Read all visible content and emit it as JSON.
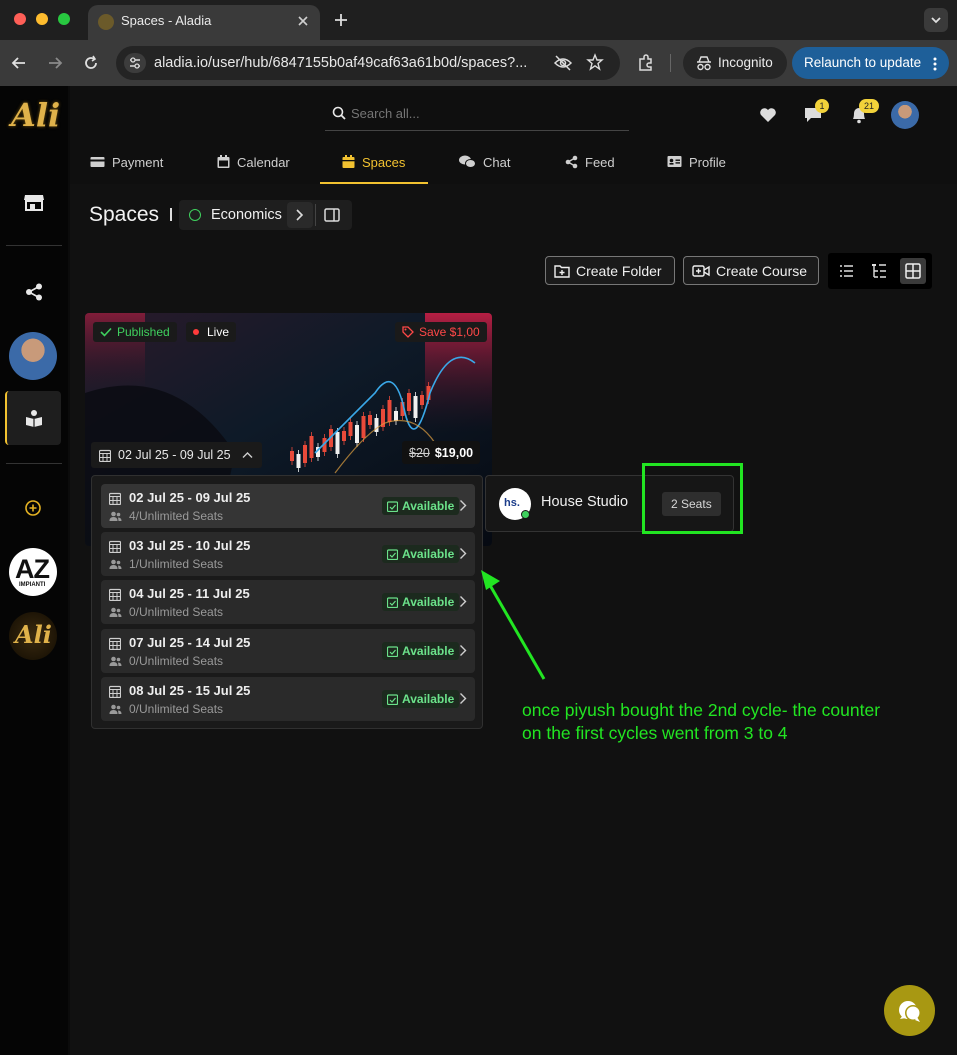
{
  "browser": {
    "tab_title": "Spaces - Aladia",
    "url": "aladia.io/user/hub/6847155b0af49caf63a61b0d/spaces?...",
    "incognito_label": "Incognito",
    "relaunch_label": "Relaunch to update"
  },
  "header": {
    "logo_text": "Ali",
    "search_placeholder": "Search all...",
    "messages_count": "1",
    "notifications_count": "21"
  },
  "nav": {
    "tabs": [
      {
        "label": "Payment",
        "icon": "credit-card-icon"
      },
      {
        "label": "Calendar",
        "icon": "calendar-icon"
      },
      {
        "label": "Spaces",
        "icon": "folder-icon"
      },
      {
        "label": "Chat",
        "icon": "chat-icon"
      },
      {
        "label": "Feed",
        "icon": "share-icon"
      },
      {
        "label": "Profile",
        "icon": "id-card-icon"
      }
    ],
    "active": "Spaces"
  },
  "sidebar": {
    "az_logo": "AZ",
    "az_sub": "IMPIANTI",
    "ali_logo": "Ali"
  },
  "page": {
    "title": "Spaces",
    "breadcrumb": "Economics",
    "create_folder": "Create Folder",
    "create_course": "Create Course"
  },
  "course_card": {
    "published": "Published",
    "live": "Live",
    "save": "Save $1,00",
    "old_price": "$20",
    "price": "$19,00",
    "date_range": "02 Jul 25 - 09 Jul 25"
  },
  "cycles": [
    {
      "dates": "02 Jul 25 - 09 Jul 25",
      "seats": "4/Unlimited Seats",
      "status": "Available"
    },
    {
      "dates": "03 Jul 25 - 10 Jul 25",
      "seats": "1/Unlimited Seats",
      "status": "Available"
    },
    {
      "dates": "04 Jul 25 - 11 Jul 25",
      "seats": "0/Unlimited Seats",
      "status": "Available"
    },
    {
      "dates": "07 Jul 25 - 14 Jul 25",
      "seats": "0/Unlimited Seats",
      "status": "Available"
    },
    {
      "dates": "08 Jul 25 - 15 Jul 25",
      "seats": "0/Unlimited Seats",
      "status": "Available"
    }
  ],
  "studio": {
    "avatar_text": "hs.",
    "name": "House Studio",
    "seats": "2 Seats"
  },
  "annotation": {
    "text_line1": "once piyush bought the 2nd cycle- the counter",
    "text_line2": "on the first cycles went from 3 to 4"
  },
  "colors": {
    "accent": "#f2c230",
    "annotation": "#22e522",
    "available": "#6be28a",
    "relaunch": "#1e5f99"
  }
}
